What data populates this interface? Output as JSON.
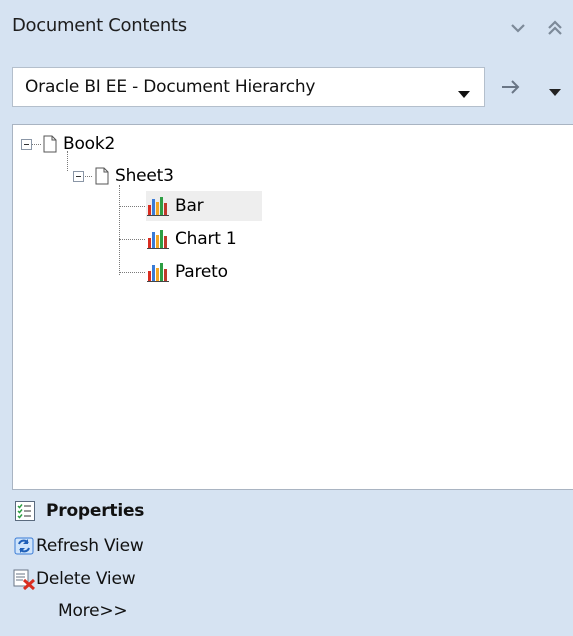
{
  "header": {
    "title": "Document Contents"
  },
  "combo": {
    "selected": "Oracle BI EE - Document Hierarchy"
  },
  "tree": {
    "root": {
      "label": "Book2"
    },
    "sheet": {
      "label": "Sheet3"
    },
    "views": [
      {
        "label": "Bar"
      },
      {
        "label": "Chart 1"
      },
      {
        "label": "Pareto"
      }
    ]
  },
  "actions": {
    "properties": "Properties",
    "refresh": "Refresh View",
    "delete": "Delete View",
    "more": "More>>"
  },
  "icons": {
    "header_collapse": "chevron-down-icon",
    "header_expand": "double-chevron-up-icon",
    "go": "arrow-right-icon",
    "menu": "triangle-down-icon",
    "document": "document-icon",
    "view": "bar-chart-icon",
    "properties": "properties-icon",
    "refresh": "refresh-icon",
    "delete": "delete-view-icon"
  },
  "colors": {
    "panel_bg": "#d6e3f2",
    "selection": "#eeeeee"
  }
}
